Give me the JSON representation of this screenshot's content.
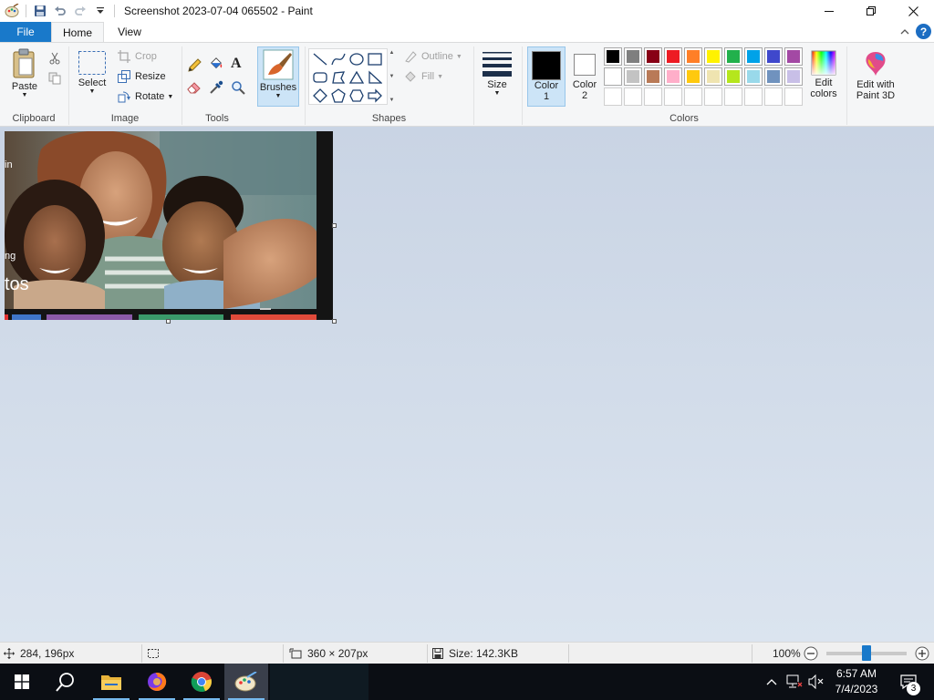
{
  "window": {
    "title": "Screenshot 2023-07-04 065502 - Paint"
  },
  "tabs": {
    "file": "File",
    "home": "Home",
    "view": "View",
    "help": "?"
  },
  "ribbon": {
    "clipboard": {
      "group_label": "Clipboard",
      "paste_label": "Paste"
    },
    "image": {
      "group_label": "Image",
      "select_label": "Select",
      "crop_label": "Crop",
      "resize_label": "Resize",
      "rotate_label": "Rotate"
    },
    "tools": {
      "group_label": "Tools",
      "text_tool": "A"
    },
    "brushes": {
      "label": "Brushes"
    },
    "shapes": {
      "group_label": "Shapes",
      "outline_label": "Outline",
      "fill_label": "Fill"
    },
    "size": {
      "label": "Size"
    },
    "colors": {
      "group_label": "Colors",
      "color1_label": "Color",
      "color1_num": "1",
      "color2_label": "Color",
      "color2_num": "2",
      "color1_value": "#000000",
      "color2_value": "#ffffff",
      "edit_colors_line1": "Edit",
      "edit_colors_line2": "colors",
      "paint3d_line1": "Edit with",
      "paint3d_line2": "Paint 3D",
      "palette_row1": [
        "#000000",
        "#7f7f7f",
        "#880015",
        "#ed1c24",
        "#ff7f27",
        "#fff200",
        "#22b14c",
        "#00a2e8",
        "#3f48cc",
        "#a349a4"
      ],
      "palette_row2": [
        "#ffffff",
        "#c3c3c3",
        "#b97a57",
        "#ffaec9",
        "#ffc90e",
        "#efe4b0",
        "#b5e61d",
        "#99d9ea",
        "#7092be",
        "#c8bfe7"
      ],
      "palette_row3": [
        "#ffffff",
        "#ffffff",
        "#ffffff",
        "#ffffff",
        "#ffffff",
        "#ffffff",
        "#ffffff",
        "#ffffff",
        "#ffffff",
        "#ffffff"
      ]
    }
  },
  "canvas": {
    "side_text_1": "in",
    "side_text_2": "ng",
    "side_text_3": "tos"
  },
  "status": {
    "cursor_pos": "284, 196px",
    "image_size": "360 × 207px",
    "file_size": "Size: 142.3KB",
    "zoom": "100%",
    "zoom_level_percent": 100
  },
  "taskbar": {
    "time": "6:57 AM",
    "date": "7/4/2023",
    "notification_count": "3"
  }
}
